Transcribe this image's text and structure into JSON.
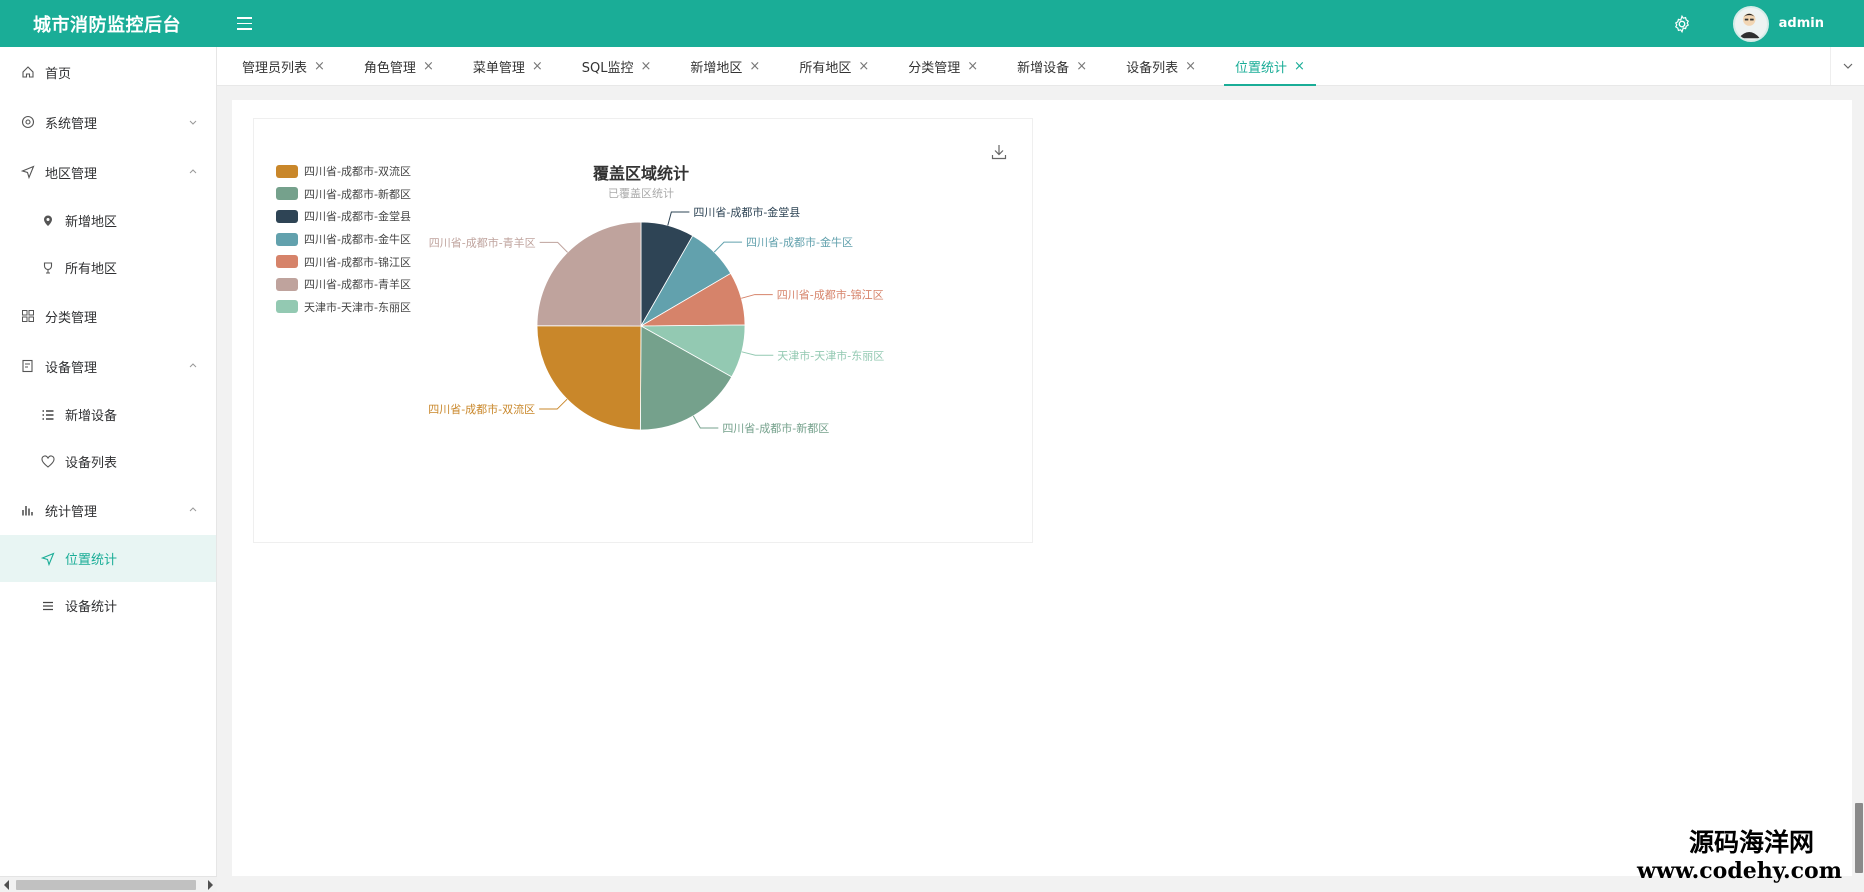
{
  "header": {
    "brand": "城市消防监控后台",
    "username": "admin"
  },
  "sidebar": {
    "home": "首页",
    "system": "系统管理",
    "region": "地区管理",
    "region_add": "新增地区",
    "region_all": "所有地区",
    "category": "分类管理",
    "device": "设备管理",
    "device_add": "新增设备",
    "device_list": "设备列表",
    "stats": "统计管理",
    "stats_location": "位置统计",
    "stats_device": "设备统计"
  },
  "tabs": [
    {
      "label": "管理员列表"
    },
    {
      "label": "角色管理"
    },
    {
      "label": "菜单管理"
    },
    {
      "label": "SQL监控"
    },
    {
      "label": "新增地区"
    },
    {
      "label": "所有地区"
    },
    {
      "label": "分类管理"
    },
    {
      "label": "新增设备"
    },
    {
      "label": "设备列表"
    },
    {
      "label": "位置统计"
    }
  ],
  "tab_close_glyph": "×",
  "chart_data": {
    "type": "pie",
    "title": "覆盖区域统计",
    "subtitle": "已覆盖区统计",
    "legend_position": "top-left",
    "categories": [
      "四川省-成都市-双流区",
      "四川省-成都市-新都区",
      "四川省-成都市-金堂县",
      "四川省-成都市-金牛区",
      "四川省-成都市-锦江区",
      "四川省-成都市-青羊区",
      "天津市-天津市-东丽区"
    ],
    "values": [
      25,
      17,
      8.3,
      8.3,
      8.3,
      25,
      8.3
    ],
    "colors": [
      "#c9872a",
      "#75a18c",
      "#2e4455",
      "#62a1ad",
      "#d6836a",
      "#bfa39d",
      "#93c9b2"
    ],
    "series": [
      {
        "name": "已覆盖区统计",
        "data": [
          {
            "name": "四川省-成都市-金堂县",
            "value": 8.3
          },
          {
            "name": "四川省-成都市-金牛区",
            "value": 8.3
          },
          {
            "name": "四川省-成都市-锦江区",
            "value": 8.3
          },
          {
            "name": "天津市-天津市-东丽区",
            "value": 8.3
          },
          {
            "name": "四川省-成都市-新都区",
            "value": 17
          },
          {
            "name": "四川省-成都市-双流区",
            "value": 25
          },
          {
            "name": "四川省-成都市-青羊区",
            "value": 25
          }
        ]
      }
    ]
  },
  "watermark": {
    "line1": "源码海洋网",
    "line2": "www.codehy.com"
  }
}
